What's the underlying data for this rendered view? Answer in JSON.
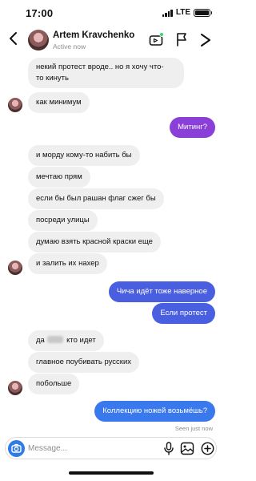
{
  "status_bar": {
    "time": "17:00",
    "network": "LTE"
  },
  "header": {
    "contact_name": "Artem Kravchenko",
    "contact_status": "Active now"
  },
  "messages": [
    {
      "id": "m1",
      "sender": "them",
      "text": "некий протест вроде.. но я хочу что-"
    },
    {
      "id": "m1b",
      "sender": "them",
      "text": "то кинуть"
    },
    {
      "id": "m2",
      "sender": "them",
      "text": "как минимум"
    },
    {
      "id": "m3",
      "sender": "me",
      "text": "Митинг?"
    },
    {
      "id": "m4",
      "sender": "them",
      "text": "и морду кому-то набить бы"
    },
    {
      "id": "m5",
      "sender": "them",
      "text": "мечтаю прям"
    },
    {
      "id": "m6",
      "sender": "them",
      "text": "если бы был рашан флаг сжег бы"
    },
    {
      "id": "m7",
      "sender": "them",
      "text": "посреди улицы"
    },
    {
      "id": "m8",
      "sender": "them",
      "text": "думаю взять красной краски еще"
    },
    {
      "id": "m9",
      "sender": "them",
      "text": "и залить их нахер"
    },
    {
      "id": "m10",
      "sender": "me",
      "text": "Чича идёт тоже наверное"
    },
    {
      "id": "m11",
      "sender": "me",
      "text": "Если протест"
    },
    {
      "id": "m12a",
      "sender": "them",
      "text": "да"
    },
    {
      "id": "m12b",
      "sender": "them",
      "text": "кто идет"
    },
    {
      "id": "m13",
      "sender": "them",
      "text": "главное поубивать русских"
    },
    {
      "id": "m14",
      "sender": "them",
      "text": "побольше"
    },
    {
      "id": "m15",
      "sender": "me",
      "text": "Коллекцию ножей возьмёшь?"
    }
  ],
  "seen_label": "Seen just now",
  "composer": {
    "placeholder": "Message..."
  },
  "colors": {
    "incoming": "#efefef",
    "outgoing_purple": "#8a3fd8",
    "outgoing_blue": "#4a5fe0",
    "outgoing_light_blue": "#3a78ee",
    "online": "#3bd16f"
  },
  "icons": [
    "back-icon",
    "video-call-icon",
    "flag-icon",
    "info-icon",
    "camera-icon",
    "microphone-icon",
    "gallery-icon",
    "sticker-icon"
  ]
}
